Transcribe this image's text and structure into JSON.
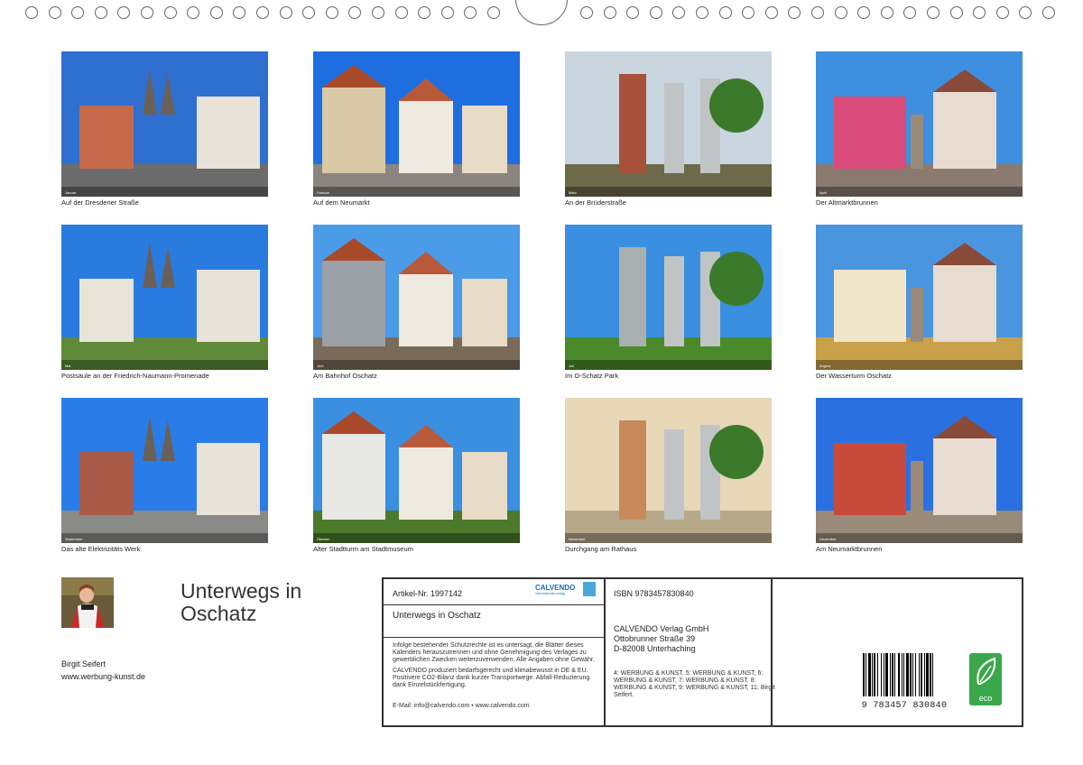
{
  "photos": [
    {
      "caption": "Auf der Dresdener Straße",
      "month": "Januar",
      "colors": {
        "sky": "#2f6fd0",
        "ground": "#6b6b6b",
        "accent": "#c46a4a"
      }
    },
    {
      "caption": "Auf dem Neumarkt",
      "month": "Februar",
      "colors": {
        "sky": "#1f6ee0",
        "ground": "#8a8580",
        "accent": "#d9c9a8"
      }
    },
    {
      "caption": "An der Brüderstraße",
      "month": "März",
      "colors": {
        "sky": "#c9d6e0",
        "ground": "#6d6a4a",
        "accent": "#a8513a"
      }
    },
    {
      "caption": "Der Altmarktbrunnen",
      "month": "April",
      "colors": {
        "sky": "#3f8fe0",
        "ground": "#8a7a70",
        "accent": "#d94b7a"
      }
    },
    {
      "caption": "Postsäule an der Friedrich-Naumann-Promenade",
      "month": "Mai",
      "colors": {
        "sky": "#2a7be0",
        "ground": "#5f8a3a",
        "accent": "#e8e4d8"
      }
    },
    {
      "caption": "Am Bahnhof Oschatz",
      "month": "Juni",
      "colors": {
        "sky": "#4a9be8",
        "ground": "#7a6a5a",
        "accent": "#9aa0a6"
      }
    },
    {
      "caption": "Im O-Schatz Park",
      "month": "Juli",
      "colors": {
        "sky": "#3a8fe0",
        "ground": "#4a8a2a",
        "accent": "#a8b0b0"
      }
    },
    {
      "caption": "Der Wasserturm Oschatz",
      "month": "August",
      "colors": {
        "sky": "#4a95e0",
        "ground": "#c8a04a",
        "accent": "#f2e6c8"
      }
    },
    {
      "caption": "Das alte Elektrizitäts Werk",
      "month": "September",
      "colors": {
        "sky": "#2a7de8",
        "ground": "#8a8a88",
        "accent": "#a85a48"
      }
    },
    {
      "caption": "Alter Stadtturm am Stadtmuseum",
      "month": "Oktober",
      "colors": {
        "sky": "#3a8fe0",
        "ground": "#4a7a2a",
        "accent": "#e8e8e4"
      }
    },
    {
      "caption": "Durchgang am Rathaus",
      "month": "November",
      "colors": {
        "sky": "#e8d8b8",
        "ground": "#b8a88a",
        "accent": "#c88a5a"
      }
    },
    {
      "caption": "Am Neumarktbrunnen",
      "month": "Dezember",
      "colors": {
        "sky": "#2a70e0",
        "ground": "#9a8a7a",
        "accent": "#c84a3a"
      }
    }
  ],
  "title_line1": "Unterwegs in",
  "title_line2": "Oschatz",
  "author_name": "Birgit Seifert",
  "author_url": "www.werbung-kunst.de",
  "info": {
    "artikel": "Artikel-Nr. 1997142",
    "logo": "CALVENDO",
    "logo_sub": "mein kalender-verlag",
    "product_title": "Unterwegs in Oschatz",
    "legal1": "Infolge bestehender Schutzrechte ist es untersagt, die Blätter dieses Kalenders herauszutrennen und ohne Genehmigung des Verlages zu gewerblichen Zwecken weiterzuverwenden. Alle Angaben ohne Gewähr.",
    "legal2": "CALVENDO produziert bedarfsgerecht und klimabewusst in DE & EU. Positivere CO2-Bilanz dank kurzer Transportwege. Abfall-Reduzierung dank Einzelstückfertigung.",
    "contact": "E-Mail: info@calvendo.com • www.calvendo.com",
    "isbn": "ISBN 9783457830840",
    "publisher1": "CALVENDO Verlag GmbH",
    "publisher2": "Ottobrunner Straße 39",
    "publisher3": "D-82008 Unterhaching",
    "credits": "4: WERBUNG & KUNST, 5: WERBUNG & KUNST, 6: WERBUNG & KUNST, 7: WERBUNG & KUNST, 8: WERBUNG & KUNST, 9: WERBUNG & KUNST, 11: Birgit Seifert.",
    "barcode_digits": "9 783457 830840",
    "eco": "eco"
  }
}
